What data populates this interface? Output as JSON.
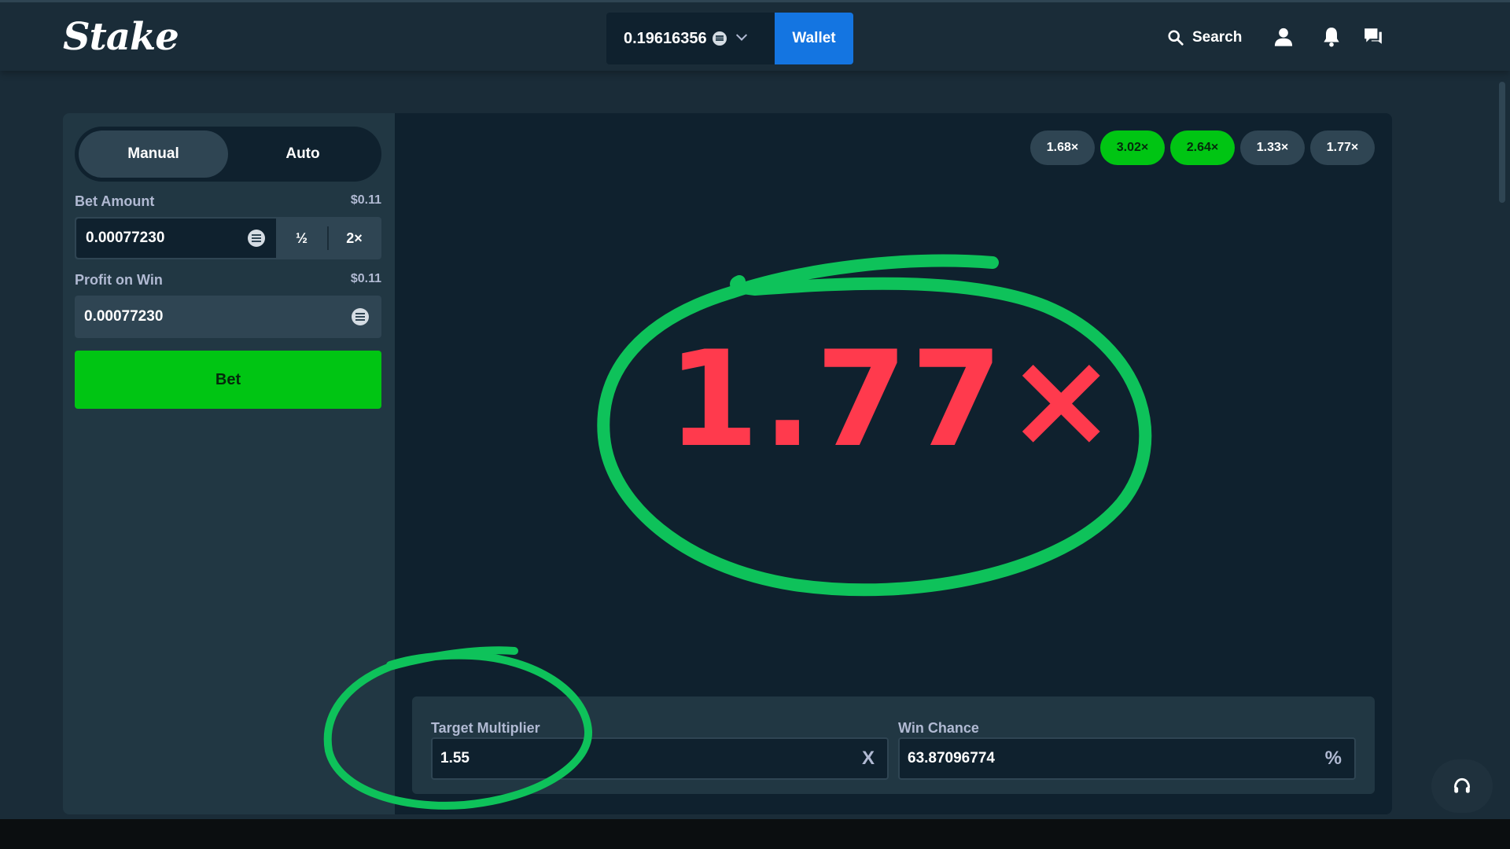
{
  "header": {
    "logo": "Stake",
    "balance": "0.19616356",
    "wallet_label": "Wallet",
    "search_label": "Search"
  },
  "sidebar": {
    "modes": [
      {
        "label": "Manual",
        "active": true
      },
      {
        "label": "Auto",
        "active": false
      }
    ],
    "bet_amount": {
      "label": "Bet Amount",
      "usd": "$0.11",
      "value": "0.00077230",
      "half_label": "½",
      "double_label": "2×"
    },
    "profit_on_win": {
      "label": "Profit on Win",
      "usd": "$0.11",
      "value": "0.00077230"
    },
    "bet_button": "Bet"
  },
  "game": {
    "history": [
      {
        "label": "1.68×",
        "win": false
      },
      {
        "label": "3.02×",
        "win": true
      },
      {
        "label": "2.64×",
        "win": true
      },
      {
        "label": "1.33×",
        "win": false
      },
      {
        "label": "1.77×",
        "win": false
      }
    ],
    "result": "1.77×",
    "target_multiplier": {
      "label": "Target Multiplier",
      "value": "1.55",
      "suffix": "X"
    },
    "win_chance": {
      "label": "Win Chance",
      "value": "63.87096774",
      "suffix": "%"
    }
  },
  "colors": {
    "background": "#1a2c38",
    "panel": "#213743",
    "input": "#0f212e",
    "accent_blue": "#1475e1",
    "win_green": "#00c513",
    "loss_red": "#ff3a4d",
    "annotation_green": "#0ec25a"
  },
  "icons": {
    "search": "search-icon",
    "user": "user-icon",
    "notifications": "bell-icon",
    "chat": "chat-icon",
    "support": "headset-icon",
    "currency": "currency-coin-icon"
  }
}
